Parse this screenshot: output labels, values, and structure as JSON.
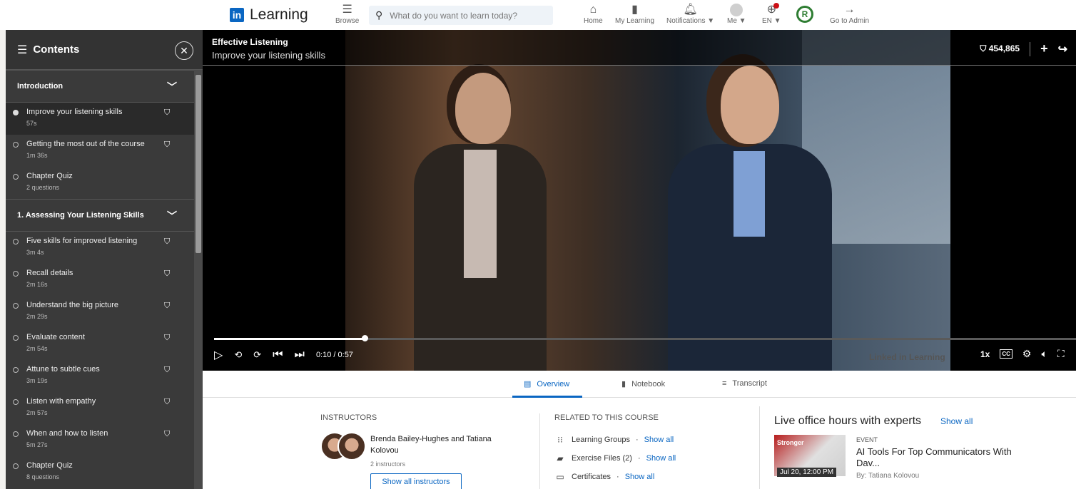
{
  "topnav": {
    "logo_mark": "in",
    "logo_text": "Learning",
    "browse": "Browse",
    "search_placeholder": "What do you want to learn today?",
    "home": "Home",
    "my_learning": "My Learning",
    "notifications": "Notifications ▼",
    "me": "Me ▼",
    "language": "EN ▼",
    "badge": "R",
    "go_to_admin": "Go to Admin"
  },
  "sidebar": {
    "title": "Contents",
    "chapters": [
      {
        "title": "Introduction",
        "items": [
          {
            "name": "Improve your listening skills",
            "duration": "57s",
            "active": true
          },
          {
            "name": "Getting the most out of the course",
            "duration": "1m 36s"
          },
          {
            "name": "Chapter Quiz",
            "duration": "2 questions",
            "quiz": true
          }
        ]
      },
      {
        "title": "1. Assessing Your Listening Skills",
        "items": [
          {
            "name": "Five skills for improved listening",
            "duration": "3m 4s"
          },
          {
            "name": "Recall details",
            "duration": "2m 16s"
          },
          {
            "name": "Understand the big picture",
            "duration": "2m 29s"
          },
          {
            "name": "Evaluate content",
            "duration": "2m 54s"
          },
          {
            "name": "Attune to subtle cues",
            "duration": "3m 19s"
          },
          {
            "name": "Listen with empathy",
            "duration": "2m 57s"
          },
          {
            "name": "When and how to listen",
            "duration": "5m 27s"
          },
          {
            "name": "Chapter Quiz",
            "duration": "8 questions",
            "quiz": true
          }
        ]
      }
    ]
  },
  "video": {
    "course_title": "Effective Listening",
    "lesson_title": "Improve your listening skills",
    "saves": "454,865",
    "time": "0:10 / 0:57",
    "progress": 0.175,
    "speed": "1x",
    "cc": "CC",
    "watermark": "Linked in Learning"
  },
  "tabs": {
    "overview": "Overview",
    "notebook": "Notebook",
    "transcript": "Transcript"
  },
  "overview": {
    "instructors_label": "INSTRUCTORS",
    "instructors_name": "Brenda Bailey-Hughes and Tatiana Kolovou",
    "instructors_count": "2 instructors",
    "show_all_instructors": "Show all instructors",
    "related_label": "RELATED TO THIS COURSE",
    "related": [
      {
        "label": "Learning Groups",
        "link": "Show all"
      },
      {
        "label": "Exercise Files (2)",
        "link": "Show all"
      },
      {
        "label": "Certificates",
        "link": "Show all"
      }
    ],
    "live_title": "Live office hours with experts",
    "live_show_all": "Show all",
    "event_tag": "EVENT",
    "event_title": "AI Tools For Top Communicators With Dav...",
    "event_by": "By: Tatiana Kolovou",
    "event_date": "Jul 20, 12:00 PM",
    "event_img_word": "Stronger"
  }
}
